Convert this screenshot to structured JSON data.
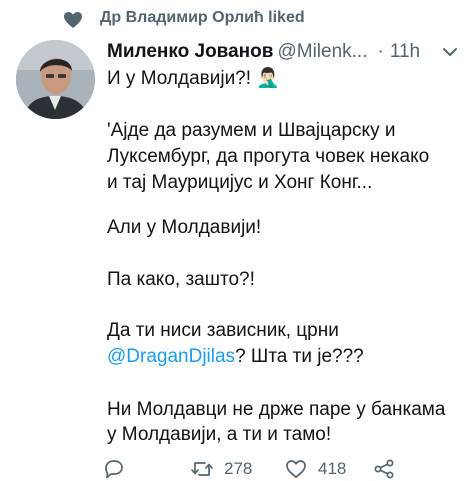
{
  "social_context": {
    "text": "Др Владимир Орлић liked"
  },
  "tweet": {
    "author_name": "Миленко Јованов",
    "handle": "@Milenk...",
    "separator": "·",
    "timestamp": "11h",
    "lines": [
      {
        "text": "И у Молдавији?! 🤦🏻‍♂️"
      },
      {
        "text": "'Ајде да разумем и Швајцарску и"
      },
      {
        "text": "Луксембург, да прогута човек некако"
      },
      {
        "text": "и тај Маурицијус и Хонг Конг..."
      },
      {
        "text": "Али у Молдавији!"
      },
      {
        "text": "Па како, зашто?!"
      },
      {
        "text": "Да ти ниси зависник, црни"
      },
      {
        "mention": "@DraganDjilas",
        "after": "? Шта ти је???"
      },
      {
        "text": "Ни Молдавци не држе паре у банкама"
      },
      {
        "text": "у Молдавији, а ти и тамо!"
      }
    ]
  },
  "actions": {
    "retweets": "278",
    "likes": "418"
  },
  "icons": {
    "liked_context": "heart-filled-icon",
    "reply": "reply-icon",
    "retweet": "retweet-icon",
    "like": "heart-outline-icon",
    "share": "share-icon",
    "more": "more-icon"
  },
  "colors": {
    "mention": "#1d9bf0",
    "secondary_text": "#536471",
    "primary_text": "#0f1419"
  }
}
